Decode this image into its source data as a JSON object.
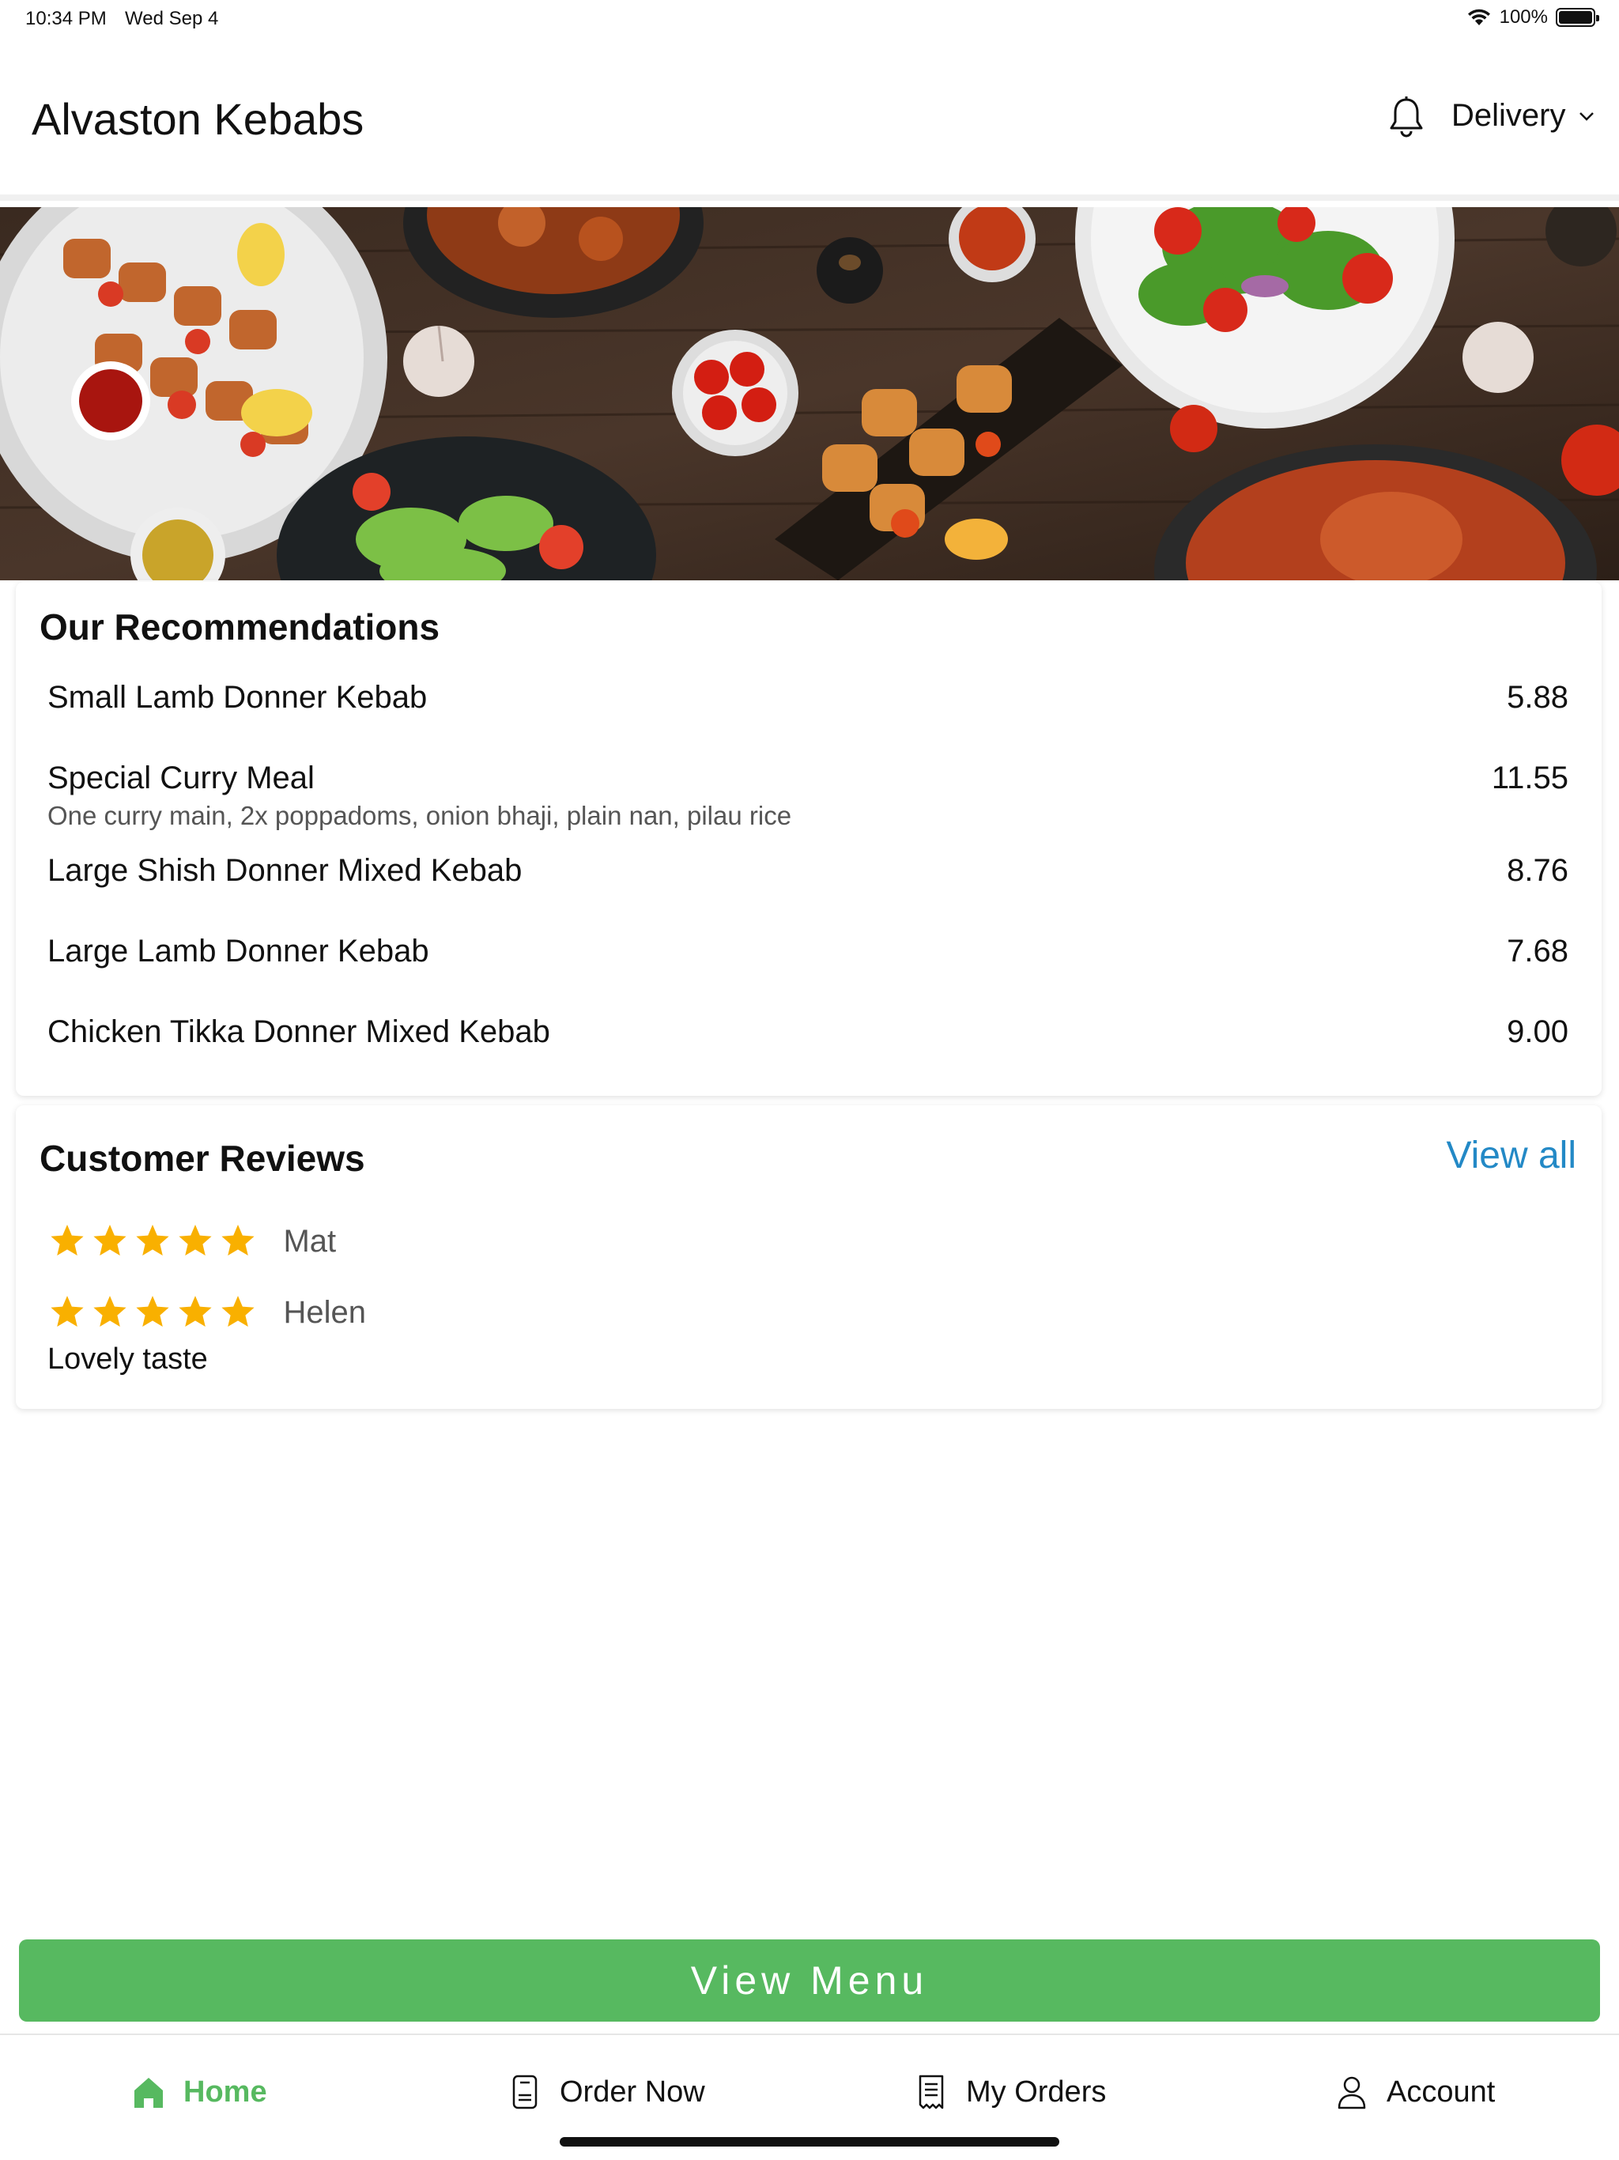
{
  "status_bar": {
    "time": "10:34 PM",
    "date": "Wed Sep 4",
    "battery": "100%"
  },
  "header": {
    "title": "Alvaston Kebabs",
    "delivery_label": "Delivery",
    "bell_icon": "bell-icon"
  },
  "recommendations": {
    "title": "Our Recommendations",
    "items": [
      {
        "name": "Small Lamb Donner Kebab",
        "description": "",
        "price": "5.88"
      },
      {
        "name": "Special Curry Meal",
        "description": "One curry main, 2x poppadoms, onion bhaji, plain nan, pilau rice",
        "price": "11.55"
      },
      {
        "name": "Large Shish Donner Mixed Kebab",
        "description": "",
        "price": "8.76"
      },
      {
        "name": "Large Lamb Donner Kebab",
        "description": "",
        "price": "7.68"
      },
      {
        "name": "Chicken Tikka Donner Mixed Kebab",
        "description": "",
        "price": "9.00"
      }
    ]
  },
  "reviews": {
    "title": "Customer Reviews",
    "view_all": "View all",
    "items": [
      {
        "name": "Mat",
        "rating": 5,
        "text": ""
      },
      {
        "name": "Helen",
        "rating": 5,
        "text": "Lovely taste"
      }
    ]
  },
  "view_menu_label": "View Menu",
  "tabs": [
    {
      "label": "Home",
      "icon": "home-icon",
      "active": true
    },
    {
      "label": "Order Now",
      "icon": "order-icon",
      "active": false
    },
    {
      "label": "My Orders",
      "icon": "receipt-icon",
      "active": false
    },
    {
      "label": "Account",
      "icon": "user-icon",
      "active": false
    }
  ],
  "colors": {
    "accent_green": "#57b960",
    "link_blue": "#2389c6",
    "star_gold": "#f9b000"
  }
}
